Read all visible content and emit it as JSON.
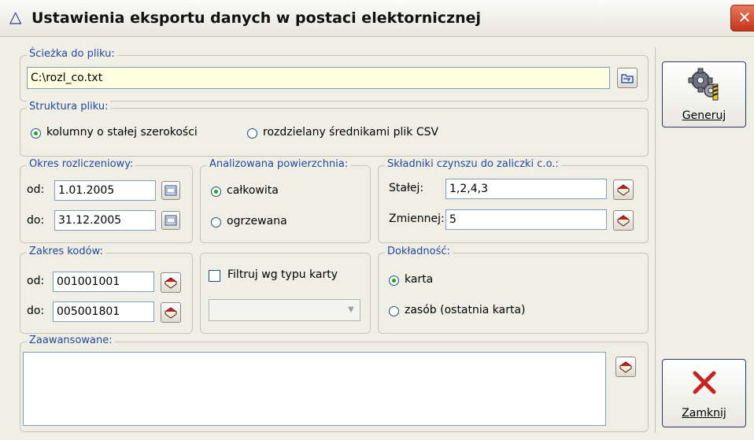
{
  "window": {
    "title": "Ustawienia eksportu danych w postaci elektornicznej"
  },
  "file_path": {
    "legend": "Ścieżka do pliku:",
    "value": "C:\\rozl_co.txt",
    "browse_icon": "folder-icon"
  },
  "structure": {
    "legend": "Struktura pliku:",
    "options": [
      {
        "label": "kolumny o stałej szerokości",
        "selected": true
      },
      {
        "label": "rozdzielany średnikami plik CSV",
        "selected": false
      }
    ]
  },
  "period": {
    "legend": "Okres rozliczeniowy:",
    "from_label": "od:",
    "from_value": "1.01.2005",
    "to_label": "do:",
    "to_value": "31.12.2005",
    "calendar_icon": "calendar-icon"
  },
  "area": {
    "legend": "Analizowana powierzchnia:",
    "options": [
      {
        "label": "całkowita",
        "selected": true
      },
      {
        "label": "ogrzewana",
        "selected": false
      }
    ]
  },
  "rent": {
    "legend": "Składniki czynszu do zaliczki c.o.:",
    "fixed_label": "Stałej:",
    "fixed_value": "1,2,4,3",
    "variable_label": "Zmiennej:",
    "variable_value": "5",
    "book_icon": "book-icon"
  },
  "codes": {
    "legend": "Zakres kodów:",
    "from_label": "od:",
    "from_value": "001001001",
    "to_label": "do:",
    "to_value": "005001801"
  },
  "filter": {
    "label": "Filtruj wg typu karty",
    "checked": false,
    "select_value": ""
  },
  "accuracy": {
    "legend": "Dokładność:",
    "options": [
      {
        "label": "karta",
        "selected": true
      },
      {
        "label": "zasób (ostatnia karta)",
        "selected": false
      }
    ]
  },
  "advanced": {
    "legend": "Zaawansowane:",
    "value": ""
  },
  "buttons": {
    "generate": {
      "label": "Generuj",
      "icon": "gears-icon"
    },
    "close": {
      "label": "Zamknij",
      "icon": "x-icon"
    }
  },
  "colors": {
    "legend_text": "#2148a0",
    "radio_dot": "#21a121",
    "path_bg": "#ffffe1",
    "close_x": "#c9211e"
  }
}
